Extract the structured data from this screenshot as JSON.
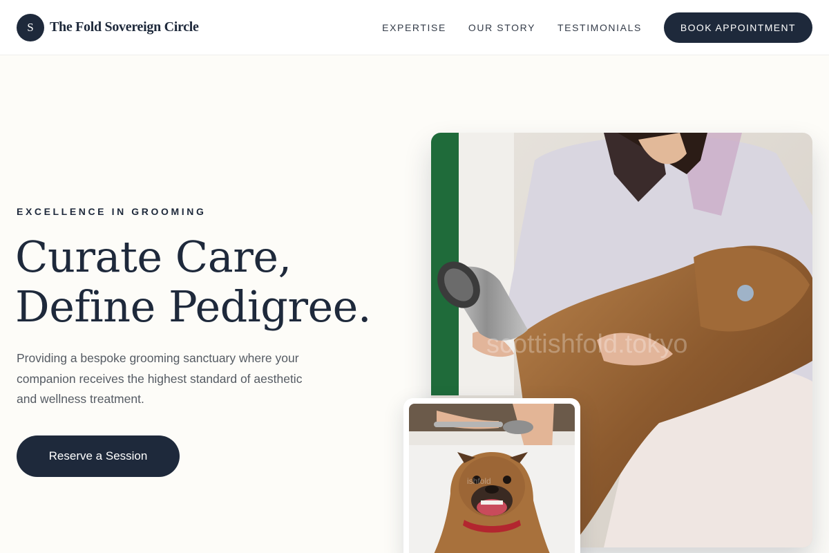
{
  "header": {
    "logo_letter": "S",
    "brand_name": "The Fold Sovereign Circle",
    "nav": [
      "EXPERTISE",
      "OUR STORY",
      "TESTIMONIALS"
    ],
    "book_label": "BOOK APPOINTMENT"
  },
  "hero": {
    "eyebrow": "EXCELLENCE IN GROOMING",
    "headline_line1": "Curate Care,",
    "headline_line2": "Define Pedigree.",
    "lead": "Providing a bespoke grooming sanctuary where your companion receives the highest standard of aesthetic and wellness treatment.",
    "cta_label": "Reserve a Session"
  },
  "images": {
    "main_watermark": "scottishfold.tokyo",
    "small_watermark": "ishfold"
  },
  "colors": {
    "navy": "#1e293b",
    "background": "#fdfcf8"
  }
}
